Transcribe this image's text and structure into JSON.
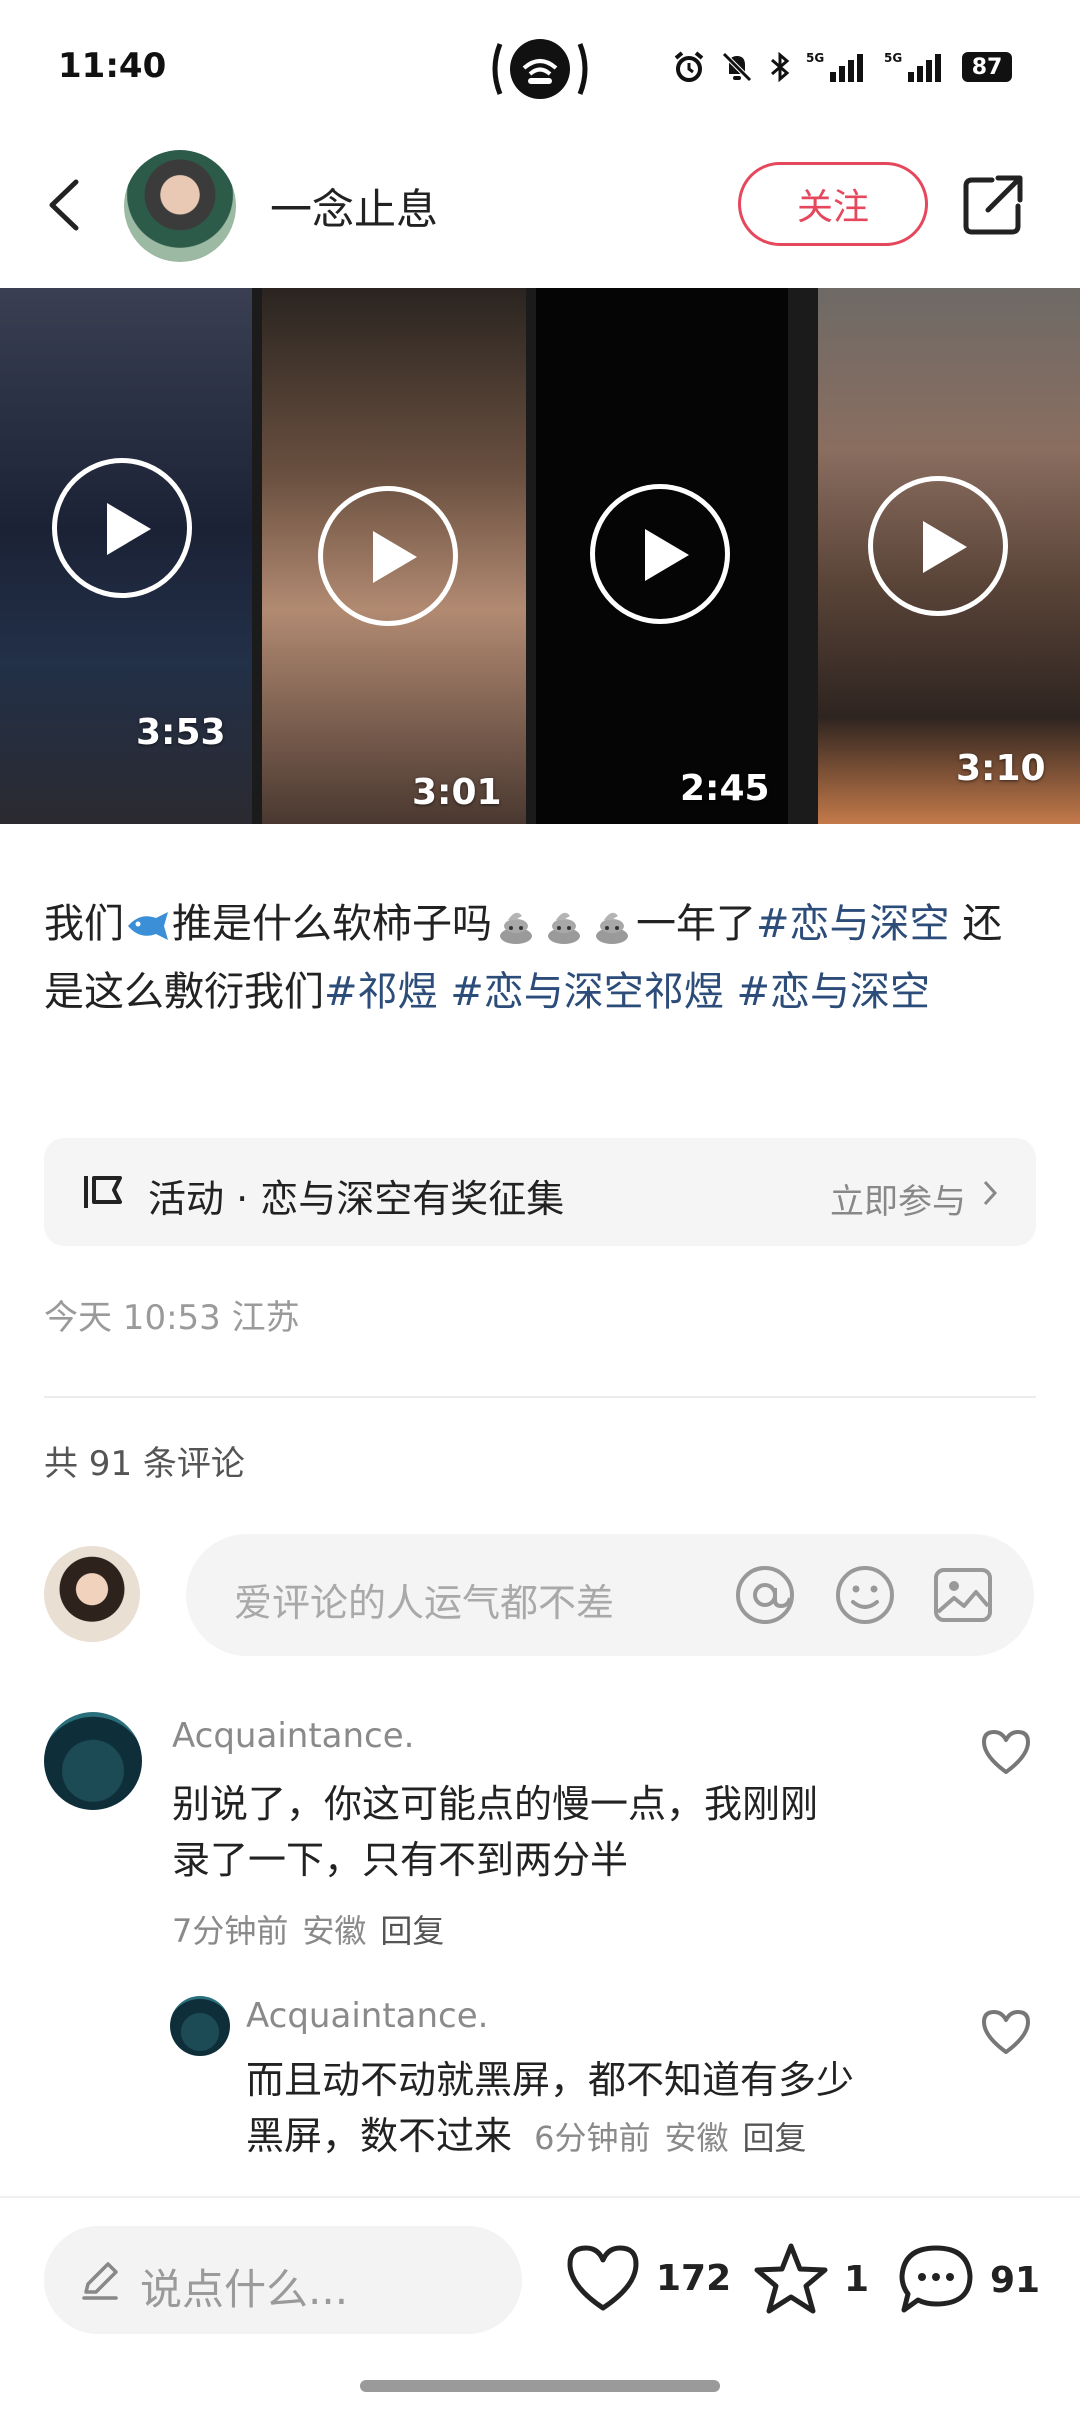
{
  "status_bar": {
    "time": "11:40",
    "battery": "87",
    "signal_1": "5G",
    "signal_2": "5G",
    "icons": [
      "hotspot-icon",
      "alarm-icon",
      "mute-icon",
      "bluetooth-icon",
      "signal-icon",
      "battery-icon"
    ]
  },
  "header": {
    "username": "一念止息",
    "follow_label": "关注"
  },
  "videos": [
    {
      "duration": "3:53"
    },
    {
      "duration": "3:01"
    },
    {
      "duration": "2:45"
    },
    {
      "duration": "3:10"
    }
  ],
  "post": {
    "text_1": "我们",
    "text_2": "推是什么软柿子吗",
    "text_3": "一年了",
    "tag_1": "#恋与深空",
    "text_4": " 还是这么敷衍我们",
    "tag_2": "#祁煜",
    "tag_3": " #恋与深空祁煜",
    "tag_4": " #恋与深空",
    "time": "今天 10:53",
    "location": "江苏"
  },
  "activity": {
    "label": "活动 · 恋与深空有奖征集",
    "join": "立即参与"
  },
  "comments_section": {
    "count_label": "共 91 条评论",
    "input_placeholder": "爱评论的人运气都不差"
  },
  "comments": [
    {
      "name": "Acquaintance.",
      "body_line1": "别说了，你这可能点的慢一点，我刚刚",
      "body_line2": "录了一下，只有不到两分半",
      "time": "7分钟前",
      "location": "安徽",
      "reply": "回复"
    },
    {
      "name": "Acquaintance.",
      "body_line1": "而且动不动就黑屏，都不知道有多少",
      "body_line2": "黑屏，数不过来",
      "time": "6分钟前",
      "location": "安徽",
      "reply": "回复"
    }
  ],
  "bottom_bar": {
    "say_placeholder": "说点什么...",
    "likes": "172",
    "favorites": "1",
    "comments": "91"
  },
  "colors": {
    "accent": "#e5485d",
    "tag": "#2c4c7a"
  }
}
